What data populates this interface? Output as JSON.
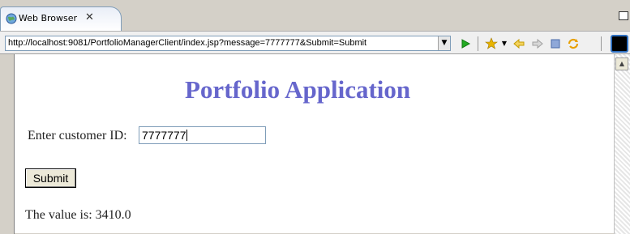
{
  "window": {
    "tab_label": "Web Browser",
    "close_glyph": "✕"
  },
  "address": {
    "url": "http://localhost:9081/PortfolioManagerClient/index.jsp?message=7777777&Submit=Submit",
    "dropdown_glyph": "▼"
  },
  "toolbar": {
    "go_icon": "go-arrow-icon",
    "favorite_icon": "star-icon",
    "back_icon": "back-arrow-icon",
    "forward_icon": "forward-arrow-icon",
    "stop_icon": "stop-icon",
    "refresh_icon": "refresh-icon"
  },
  "page": {
    "title": "Portfolio Application",
    "customer_label": "Enter customer ID:",
    "customer_value": "7777777",
    "submit_label": "Submit",
    "result_text": "The value is: 3410.0"
  },
  "colors": {
    "title": "#6666cc",
    "go_green": "#22aa22",
    "favorite_yellow": "#e8b400"
  }
}
